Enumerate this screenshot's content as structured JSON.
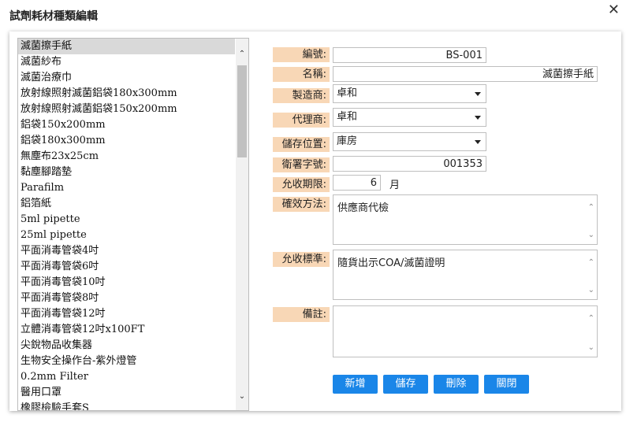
{
  "dialog": {
    "title": "試劑耗材種類編輯",
    "close_glyph": "✕"
  },
  "list": {
    "items": [
      "滅菌擦手紙",
      "滅菌紗布",
      "滅菌治療巾",
      "放射線照射滅菌鋁袋180x300mm",
      "放射線照射滅菌鋁袋150x200mm",
      "鋁袋150x200mm",
      "鋁袋180x300mm",
      "無塵布23x25cm",
      "黏塵腳踏墊",
      "Parafilm",
      "鋁箔紙",
      "5ml pipette",
      "25ml pipette",
      "平面消毒管袋4吋",
      "平面消毒管袋6吋",
      "平面消毒管袋10吋",
      "平面消毒管袋8吋",
      "平面消毒管袋12吋",
      "立體消毒管袋12吋x100FT",
      "尖銳物品收集器",
      "生物安全操作台-紫外燈管",
      "0.2mm Filter",
      "醫用口罩",
      "橡膠檢驗手套S"
    ],
    "selected_index": 0,
    "scroll_up": "⌃",
    "scroll_down": "⌄"
  },
  "form": {
    "code": {
      "label": "編號:",
      "value": "BS-001"
    },
    "name": {
      "label": "名稱:",
      "value": "滅菌擦手紙"
    },
    "manufacturer": {
      "label": "製造商:",
      "value": "卓和"
    },
    "agent": {
      "label": "代理商:",
      "value": "卓和"
    },
    "storage": {
      "label": "儲存位置:",
      "value": "庫房"
    },
    "license": {
      "label": "衛署字號:",
      "value": "001353"
    },
    "acceptance_period": {
      "label": "允收期限:",
      "value": "6",
      "unit": "月"
    },
    "verification": {
      "label": "確效方法:",
      "value": "供應商代檢"
    },
    "acceptance_std": {
      "label": "允收標準:",
      "value": "隨貨出示COA/滅菌證明"
    },
    "notes": {
      "label": "備註:",
      "value": ""
    }
  },
  "buttons": {
    "add": "新增",
    "save": "儲存",
    "delete": "刪除",
    "close": "關閉"
  },
  "colors": {
    "label_bg": "#f8d7b6",
    "button_bg": "#1a86e8",
    "selected_row": "#d9d9d9"
  }
}
